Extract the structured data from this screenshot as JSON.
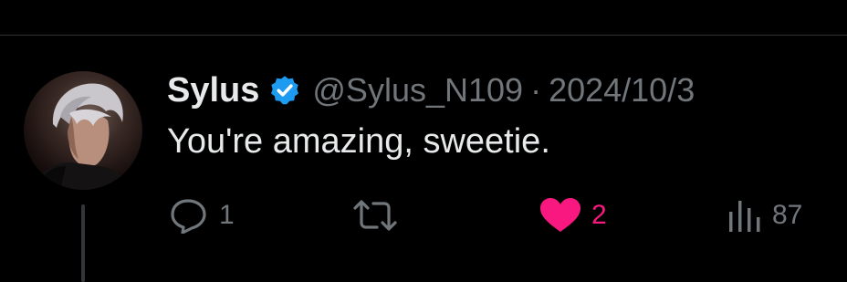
{
  "tweet": {
    "author_name": "Sylus",
    "handle": "@Sylus_N109",
    "separator": "·",
    "date": "2024/10/3",
    "text": "You're amazing, sweetie."
  },
  "actions": {
    "replies": "1",
    "likes": "2",
    "views": "87"
  },
  "icons": {
    "verified": "verified-badge-icon",
    "reply": "reply-icon",
    "retweet": "retweet-icon",
    "like": "heart-filled-icon",
    "views": "views-chart-icon"
  },
  "colors": {
    "background": "#000000",
    "text": "#e7e9ea",
    "muted": "#71767b",
    "verified": "#1d9bf0",
    "like": "#f91880"
  }
}
